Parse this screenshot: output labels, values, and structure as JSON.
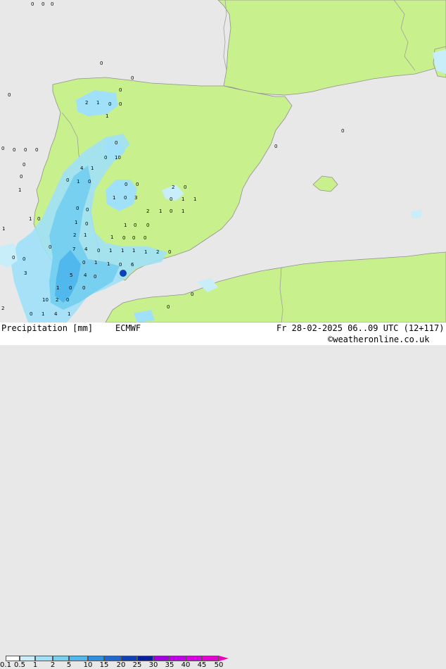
{
  "footer": {
    "title": "Precipitation [mm]",
    "model": "ECMWF",
    "valid_time": "Fr 28-02-2025 06..09 UTC (12+117)",
    "copyright": "©weatheronline.co.uk"
  },
  "legend": {
    "ticks": [
      "0.1",
      "0.5",
      "1",
      "2",
      "5",
      "10",
      "15",
      "20",
      "25",
      "30",
      "35",
      "40",
      "45",
      "50"
    ],
    "colors": [
      "#ffffff",
      "#c8eefa",
      "#a0e0f8",
      "#78d0f0",
      "#50b8ec",
      "#3090e0",
      "#2068d0",
      "#1040b8",
      "#0820a0",
      "#a000e0",
      "#c000e8",
      "#d800e0",
      "#e800d0",
      "#f000c0"
    ]
  },
  "map": {
    "colors": {
      "sea": "#e8e8e8",
      "land": "#c8f08c",
      "border": "#a0a0a0",
      "coast": "#909090"
    },
    "values": [
      "0",
      "0",
      "0",
      "0",
      "0",
      "0",
      "0",
      "2",
      "1",
      "0",
      "0",
      "1",
      "0",
      "10",
      "0",
      "0",
      "0",
      "0",
      "0",
      "4",
      "1",
      "0",
      "0",
      "1",
      "0",
      "0",
      "1",
      "0",
      "0",
      "1",
      "0",
      "3",
      "2",
      "0",
      "0",
      "1",
      "1",
      "0",
      "0",
      "2",
      "1",
      "0",
      "1",
      "1",
      "0",
      "1",
      "0",
      "0",
      "2",
      "1",
      "1",
      "0",
      "0",
      "0",
      "1",
      "1",
      "0",
      "0",
      "7",
      "4",
      "0",
      "1",
      "1",
      "1",
      "1",
      "2",
      "0",
      "0",
      "0",
      "0",
      "1",
      "1",
      "5",
      "4",
      "0",
      "0",
      "6",
      "1",
      "0",
      "0",
      "3",
      "10",
      "2",
      "0",
      "1",
      "4",
      "1",
      "2",
      "0",
      "0",
      "0",
      "0",
      "0",
      "0",
      "0"
    ]
  }
}
